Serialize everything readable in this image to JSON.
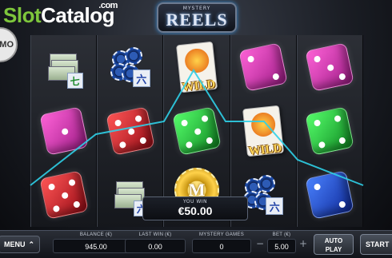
{
  "watermark": {
    "part1": "Slot",
    "part2": "Catalog",
    "suffix": ".com"
  },
  "demo_badge": "EMO",
  "logo": {
    "small": "MYSTERY",
    "big": "REELS"
  },
  "reels": [
    [
      "cash-6-icon",
      "pink-die-icon",
      "red-die-icon"
    ],
    [
      "chips-6-icon",
      "red-die-icon",
      "cash-6-icon"
    ],
    [
      "wild-card-icon",
      "green-die-icon",
      "m-chip-icon"
    ],
    [
      "pink-die-icon",
      "wild-card-icon",
      "chips-6-icon"
    ],
    [
      "pink-die-icon",
      "green-die-icon",
      "blue-die-icon"
    ]
  ],
  "symbols": {
    "wild_label": "WILD",
    "mystery_letter": "M",
    "tile_six": "六",
    "tile_seven": "七"
  },
  "win": {
    "label": "YOU WIN",
    "amount": "€50.00"
  },
  "controls": {
    "menu": "MENU",
    "balance_label": "BALANCE (€)",
    "balance_value": "945.00",
    "last_win_label": "LAST WIN (€)",
    "last_win_value": "0.00",
    "mystery_games_label": "MYSTERY GAMES",
    "mystery_games_value": "0",
    "bet_label": "BET (€)",
    "bet_value": "5.00",
    "bet_minus": "−",
    "bet_plus": "+",
    "autoplay_line1": "AUTO",
    "autoplay_line2": "PLAY",
    "start": "START"
  },
  "colors": {
    "payline": "#2fd0e8",
    "brand_green": "#7ec63c",
    "wild_gold": "#ffd75a"
  }
}
